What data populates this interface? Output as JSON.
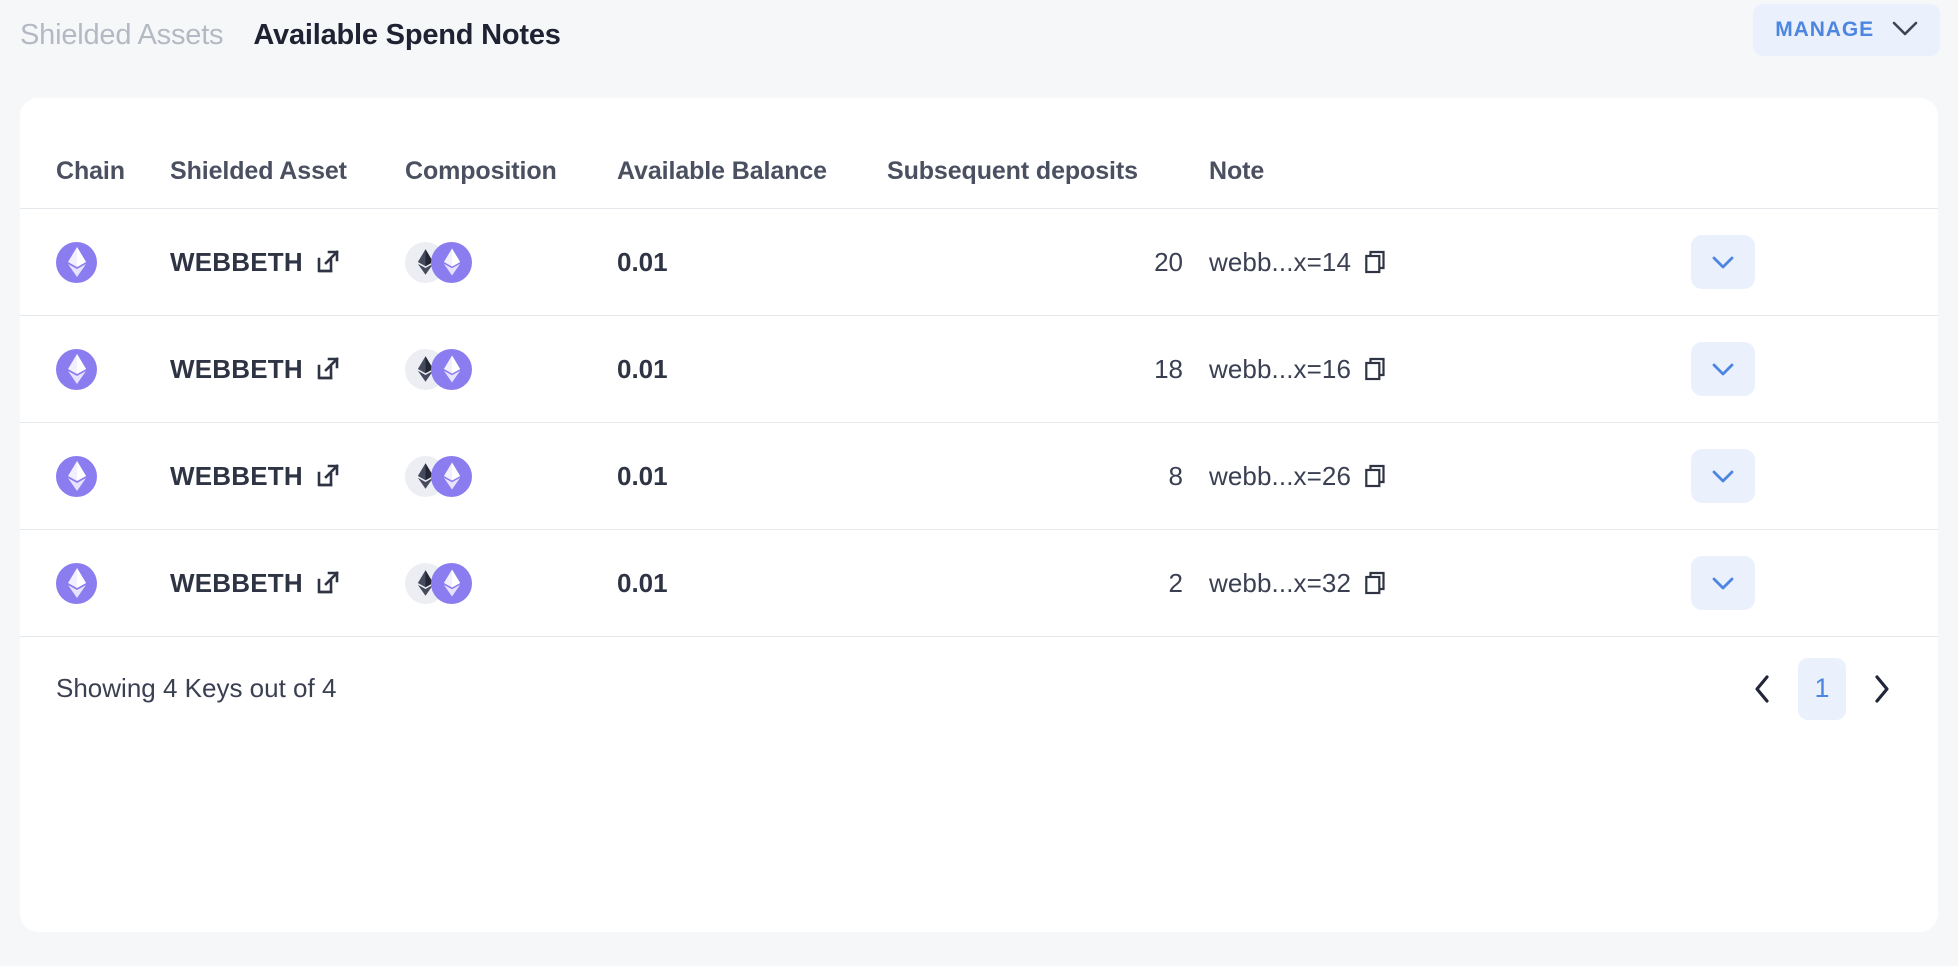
{
  "header": {
    "tabs": [
      {
        "label": "Shielded Assets",
        "active": false
      },
      {
        "label": "Available Spend Notes",
        "active": true
      }
    ],
    "manage_button": {
      "label": "MANAGE",
      "icon": "chevron-down-icon"
    },
    "accent_blue": "#4d86e0",
    "accent_blue_bg": "#eaf1fd"
  },
  "table": {
    "columns": [
      "Chain",
      "Shielded Asset",
      "Composition",
      "Available Balance",
      "Subsequent deposits",
      "Note"
    ],
    "rows": [
      {
        "chain_icon": "ethereum-purple-icon",
        "asset": "WEBBETH",
        "composition": [
          "ethereum-dark-icon",
          "ethereum-purple-icon"
        ],
        "balance": "0.01",
        "deposits": "20",
        "note": "webb...x=14"
      },
      {
        "chain_icon": "ethereum-purple-icon",
        "asset": "WEBBETH",
        "composition": [
          "ethereum-dark-icon",
          "ethereum-purple-icon"
        ],
        "balance": "0.01",
        "deposits": "18",
        "note": "webb...x=16"
      },
      {
        "chain_icon": "ethereum-purple-icon",
        "asset": "WEBBETH",
        "composition": [
          "ethereum-dark-icon",
          "ethereum-purple-icon"
        ],
        "balance": "0.01",
        "deposits": "8",
        "note": "webb...x=26"
      },
      {
        "chain_icon": "ethereum-purple-icon",
        "asset": "WEBBETH",
        "composition": [
          "ethereum-dark-icon",
          "ethereum-purple-icon"
        ],
        "balance": "0.01",
        "deposits": "2",
        "note": "webb...x=32"
      }
    ]
  },
  "footer": {
    "showing": "Showing 4 Keys out of 4",
    "pagination": {
      "prev_icon": "chevron-left-icon",
      "next_icon": "chevron-right-icon",
      "current_page": "1"
    }
  },
  "colors": {
    "page_background": "#f6f7f8",
    "card_background": "#ffffff",
    "token_purple": "#8b7cf0",
    "token_grey": "#eceef3",
    "divider": "#e5e8ed",
    "text_primary": "#2f3444",
    "text_muted": "#b4b9c4"
  }
}
